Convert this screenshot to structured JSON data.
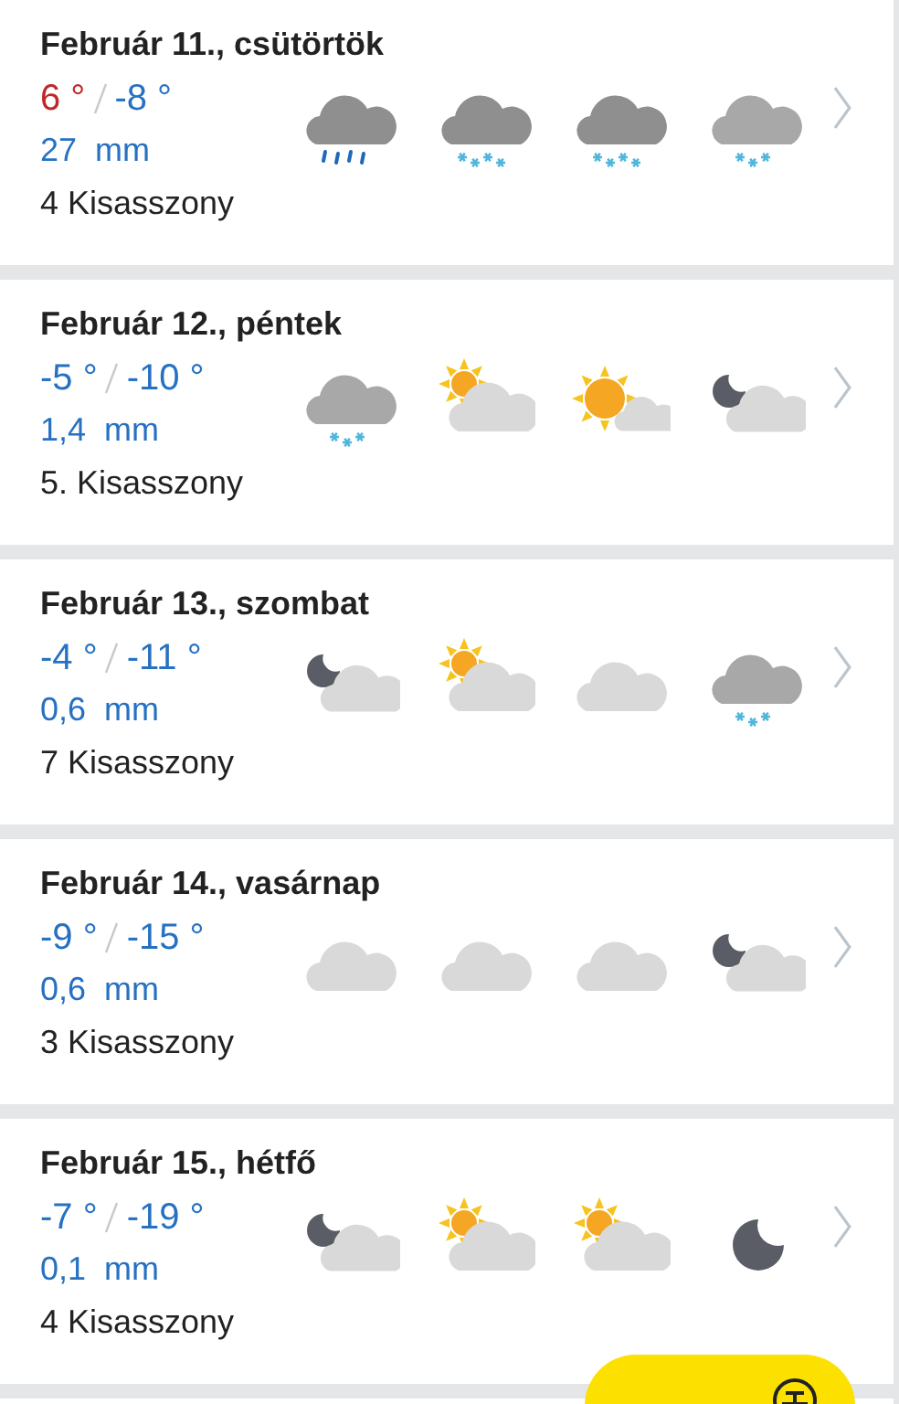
{
  "days": [
    {
      "date": "Február 11., csütörtök",
      "high": "6 °",
      "high_warm": true,
      "low": "-8 °",
      "precip": "27  mm",
      "nameday": "4 Kisasszony",
      "icons": [
        {
          "kind": "rain"
        },
        {
          "kind": "snow"
        },
        {
          "kind": "snow"
        },
        {
          "kind": "light_snow"
        }
      ]
    },
    {
      "date": "Február 12., péntek",
      "high": "-5 °",
      "high_warm": false,
      "low": "-10 °",
      "precip": "1,4  mm",
      "nameday": "5. Kisasszony",
      "icons": [
        {
          "kind": "light_snow"
        },
        {
          "kind": "sun_cloud"
        },
        {
          "kind": "sunny_cloud"
        },
        {
          "kind": "moon_cloud"
        }
      ]
    },
    {
      "date": "Február 13., szombat",
      "high": "-4 °",
      "high_warm": false,
      "low": "-11 °",
      "precip": "0,6  mm",
      "nameday": "7 Kisasszony",
      "icons": [
        {
          "kind": "moon_cloud"
        },
        {
          "kind": "sun_cloud"
        },
        {
          "kind": "cloud"
        },
        {
          "kind": "light_snow"
        }
      ]
    },
    {
      "date": "Február 14., vasárnap",
      "high": "-9 °",
      "high_warm": false,
      "low": "-15 °",
      "precip": "0,6  mm",
      "nameday": "3 Kisasszony",
      "icons": [
        {
          "kind": "cloud"
        },
        {
          "kind": "cloud"
        },
        {
          "kind": "cloud"
        },
        {
          "kind": "moon_cloud"
        }
      ]
    },
    {
      "date": "Február 15., hétfő",
      "high": "-7 °",
      "high_warm": false,
      "low": "-19 °",
      "precip": "0,1  mm",
      "nameday": "4 Kisasszony",
      "icons": [
        {
          "kind": "moon_cloud"
        },
        {
          "kind": "sun_cloud"
        },
        {
          "kind": "sun_cloud"
        },
        {
          "kind": "moon"
        }
      ]
    }
  ]
}
